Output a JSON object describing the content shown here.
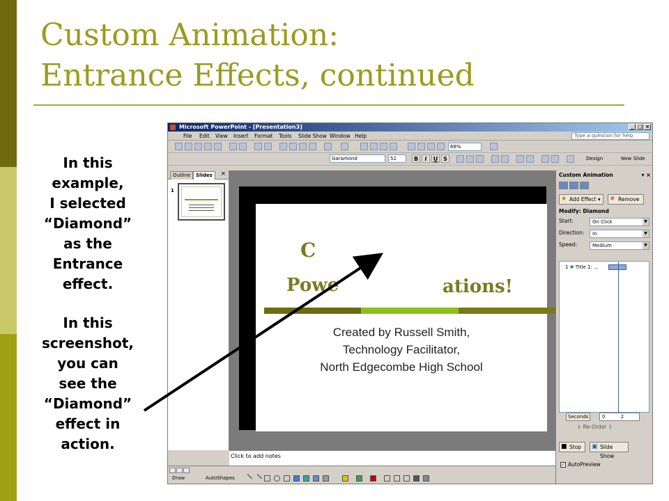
{
  "page": {
    "title_line1": "Custom Animation:",
    "title_line2": "Entrance Effects, continued",
    "caption1": "In this\nexample,\nI selected\n“Diamond”\nas the\nEntrance\neffect.",
    "caption2": "In this\nscreenshot,\nyou can\nsee the\n“Diamond”\neffect in\naction.",
    "accent_colors": [
      "#6f6a0c",
      "#c9c96a",
      "#a0a014"
    ]
  },
  "window": {
    "title": "Microsoft PowerPoint - [Presentation3]",
    "menu": [
      "File",
      "Edit",
      "View",
      "Insert",
      "Format",
      "Tools",
      "Slide Show",
      "Window",
      "Help"
    ],
    "help_placeholder": "Type a question for help",
    "zoom": "68%",
    "font": "Garamond",
    "font_size": "52",
    "design_label": "Design",
    "new_slide_label": "New Slide"
  },
  "left_panel": {
    "tabs": [
      "Outline",
      "Slides"
    ],
    "slide_number": "1"
  },
  "slide": {
    "frag1": "C",
    "frag2": "Powe",
    "frag3": "ations!",
    "subtitle_lines": [
      "Created by Russell Smith,",
      "Technology Facilitator,",
      "North Edgecombe High School"
    ],
    "band_colors": [
      "#6b6b10",
      "#8fbf1a",
      "#7a7a16"
    ]
  },
  "notes": {
    "placeholder": "Click to add notes"
  },
  "drawing": {
    "draw_label": "Draw",
    "autoshapes_label": "AutoShapes"
  },
  "task_pane": {
    "title": "Custom Animation",
    "add_effect": "Add Effect",
    "remove": "Remove",
    "modify": "Modify: Diamond",
    "start_label": "Start:",
    "start_value": "On Click",
    "direction_label": "Direction:",
    "direction_value": "In",
    "speed_label": "Speed:",
    "speed_value": "Medium",
    "list_item": "Title 1: ...",
    "list_index": "1",
    "seconds_label": "Seconds",
    "seconds_start": "0",
    "seconds_end": "2",
    "reorder": "Re-Order",
    "stop": "Stop",
    "slide_show": "Slide Show",
    "autopreview": "AutoPreview"
  }
}
